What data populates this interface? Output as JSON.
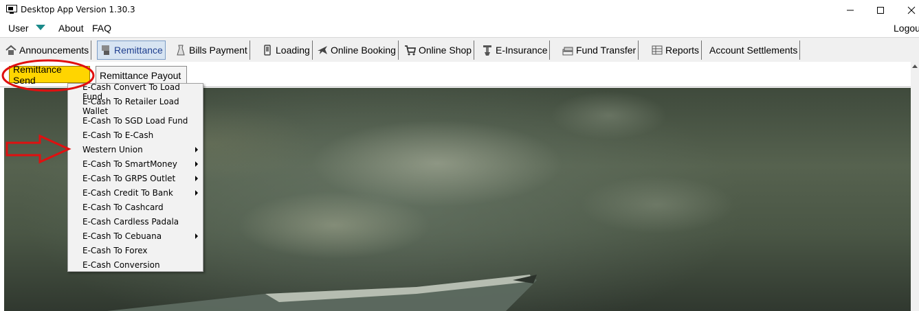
{
  "window": {
    "title": "Desktop App Version 1.30.3"
  },
  "menubar": {
    "user": "User",
    "about": "About",
    "faq": "FAQ",
    "logout": "Logou"
  },
  "main_tabs": [
    {
      "label": "Announcements",
      "icon": "home-icon"
    },
    {
      "label": "Remittance",
      "icon": "remittance-icon",
      "active": true
    },
    {
      "label": "Bills Payment",
      "icon": "bills-icon"
    },
    {
      "label": "Loading",
      "icon": "phone-icon"
    },
    {
      "label": "Online Booking",
      "icon": "airplane-icon"
    },
    {
      "label": "Online Shop",
      "icon": "cart-icon"
    },
    {
      "label": "E-Insurance",
      "icon": "insurance-icon"
    },
    {
      "label": "Fund Transfer",
      "icon": "money-stack-icon"
    },
    {
      "label": "Reports",
      "icon": "report-icon"
    },
    {
      "label": "Account Settlements",
      "icon": ""
    }
  ],
  "sub_tabs": {
    "send": "Remittance Send",
    "payout": "Remittance Payout"
  },
  "dropdown": [
    {
      "label": "E-Cash Convert To Load Fund",
      "submenu": false
    },
    {
      "label": "E-Cash To Retailer Load Wallet",
      "submenu": false
    },
    {
      "label": "E-Cash To SGD Load Fund",
      "submenu": false
    },
    {
      "label": "E-Cash To E-Cash",
      "submenu": false
    },
    {
      "label": "Western Union",
      "submenu": true
    },
    {
      "label": "E-Cash To SmartMoney",
      "submenu": true
    },
    {
      "label": "E-Cash To GRPS Outlet",
      "submenu": true
    },
    {
      "label": "E-Cash Credit To Bank",
      "submenu": true
    },
    {
      "label": "E-Cash To Cashcard",
      "submenu": false
    },
    {
      "label": "E-Cash Cardless Padala",
      "submenu": false
    },
    {
      "label": "E-Cash To Cebuana",
      "submenu": true
    },
    {
      "label": "E-Cash To Forex",
      "submenu": false
    },
    {
      "label": "E-Cash Conversion",
      "submenu": false
    }
  ],
  "colors": {
    "active_subtab": "#ffd500",
    "annotation": "#e01010",
    "active_tab": "#d7e4f2"
  }
}
